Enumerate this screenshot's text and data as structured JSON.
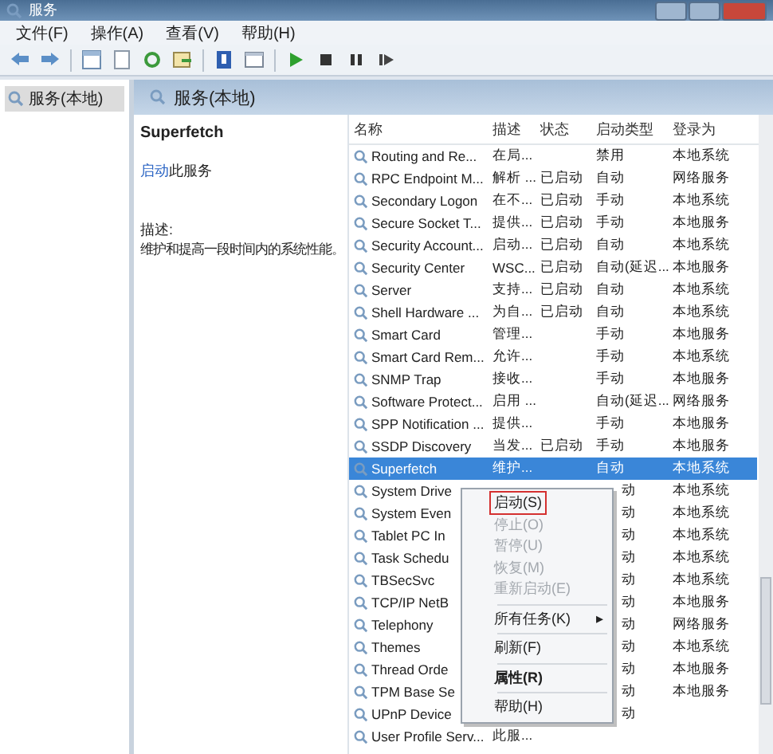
{
  "window": {
    "title": "服务"
  },
  "menu_bar": [
    "文件(F)",
    "操作(A)",
    "查看(V)",
    "帮助(H)"
  ],
  "tree": {
    "items": [
      {
        "label": "服务(本地)",
        "selected": true
      }
    ]
  },
  "header": {
    "title": "服务(本地)"
  },
  "detail": {
    "service_name": "Superfetch",
    "action_link": "启动",
    "action_rest": "此服务",
    "description_label": "描述:",
    "description": "维护和提高一段时间内的系统性能。"
  },
  "table": {
    "columns": [
      "名称",
      "描述",
      "状态",
      "启动类型",
      "登录为"
    ],
    "rows": [
      {
        "name": "Routing and Re...",
        "description": "在局...",
        "startup": "禁用",
        "logon": "本地系统",
        "selected": false
      },
      {
        "name": "RPC Endpoint M...",
        "description": "解析 ...",
        "status": "已启动",
        "startup": "自动",
        "logon": "网络服务",
        "selected": false
      },
      {
        "name": "Secondary Logon",
        "description": "在不...",
        "status": "已启动",
        "startup": "手动",
        "logon": "本地系统",
        "selected": false
      },
      {
        "name": "Secure Socket T...",
        "description": "提供...",
        "status": "已启动",
        "startup": "手动",
        "logon": "本地服务",
        "selected": false
      },
      {
        "name": "Security Account...",
        "description": "启动...",
        "status": "已启动",
        "startup": "自动",
        "logon": "本地系统",
        "selected": false
      },
      {
        "name": "Security Center",
        "description": "WSC...",
        "status": "已启动",
        "startup": "自动(延迟...",
        "logon": "本地服务",
        "selected": false
      },
      {
        "name": "Server",
        "description": "支持...",
        "status": "已启动",
        "startup": "自动",
        "logon": "本地系统",
        "selected": false
      },
      {
        "name": "Shell Hardware ...",
        "description": "为自...",
        "status": "已启动",
        "startup": "自动",
        "logon": "本地系统",
        "selected": false
      },
      {
        "name": "Smart Card",
        "description": "管理...",
        "startup": "手动",
        "logon": "本地服务",
        "selected": false
      },
      {
        "name": "Smart Card Rem...",
        "description": "允许...",
        "startup": "手动",
        "logon": "本地系统",
        "selected": false
      },
      {
        "name": "SNMP Trap",
        "description": "接收...",
        "startup": "手动",
        "logon": "本地服务",
        "selected": false
      },
      {
        "name": "Software Protect...",
        "description": "启用 ...",
        "startup": "自动(延迟...",
        "logon": "网络服务",
        "selected": false
      },
      {
        "name": "SPP Notification ...",
        "description": "提供...",
        "startup": "手动",
        "logon": "本地服务",
        "selected": false
      },
      {
        "name": "SSDP Discovery",
        "description": "当发...",
        "status": "已启动",
        "startup": "手动",
        "logon": "本地服务",
        "selected": false
      },
      {
        "name": "Superfetch",
        "description": "维护...",
        "startup": "自动",
        "logon": "本地系统",
        "selected": true
      },
      {
        "name": "System Drive",
        "startup_visible_part": "动",
        "logon": "本地系统",
        "selected": false
      },
      {
        "name": "System Even",
        "startup_visible_part": "动",
        "logon": "本地系统",
        "selected": false
      },
      {
        "name": "Tablet PC In",
        "startup_visible_part": "动",
        "logon": "本地系统",
        "selected": false
      },
      {
        "name": "Task Schedu",
        "startup_visible_part": "动",
        "logon": "本地系统",
        "selected": false
      },
      {
        "name": "TBSecSvc",
        "startup_visible_part": "动",
        "logon": "本地系统",
        "selected": false
      },
      {
        "name": "TCP/IP NetB",
        "startup_visible_part": "动",
        "logon": "本地服务",
        "selected": false
      },
      {
        "name": "Telephony",
        "startup_visible_part": "动",
        "logon": "网络服务",
        "selected": false
      },
      {
        "name": "Themes",
        "startup_visible_part": "动",
        "logon": "本地系统",
        "selected": false
      },
      {
        "name": "Thread Orde",
        "startup_visible_part": "动",
        "logon": "本地服务",
        "selected": false
      },
      {
        "name": "TPM Base Se",
        "startup_visible_part": "动",
        "logon": "本地服务",
        "selected": false
      },
      {
        "name": "UPnP Device",
        "startup_visible_part": "动",
        "selected": false
      },
      {
        "name": "User Profile Serv...",
        "description": "此服...",
        "selected": false
      }
    ]
  },
  "context_menu": [
    {
      "kind": "item",
      "label": "启动(S)",
      "disabled": false,
      "outlined": true,
      "bold": false
    },
    {
      "kind": "item",
      "label": "停止(O)",
      "disabled": true,
      "outlined": false,
      "bold": false
    },
    {
      "kind": "item",
      "label": "暂停(U)",
      "disabled": true,
      "outlined": false,
      "bold": false
    },
    {
      "kind": "item",
      "label": "恢复(M)",
      "disabled": true,
      "outlined": false,
      "bold": false
    },
    {
      "kind": "item",
      "label": "重新启动(E)",
      "disabled": true,
      "outlined": false,
      "bold": false
    },
    {
      "kind": "separator"
    },
    {
      "kind": "submenu",
      "label": "所有任务(K)",
      "arrow": "▸",
      "disabled": false,
      "outlined": false,
      "bold": false
    },
    {
      "kind": "separator"
    },
    {
      "kind": "item",
      "label": "刷新(F)",
      "disabled": false,
      "outlined": false,
      "bold": false
    },
    {
      "kind": "separator"
    },
    {
      "kind": "item",
      "label": "属性(R)",
      "disabled": false,
      "outlined": false,
      "bold": true
    },
    {
      "kind": "separator"
    },
    {
      "kind": "item",
      "label": "帮助(H)",
      "disabled": false,
      "outlined": false,
      "bold": false
    }
  ]
}
